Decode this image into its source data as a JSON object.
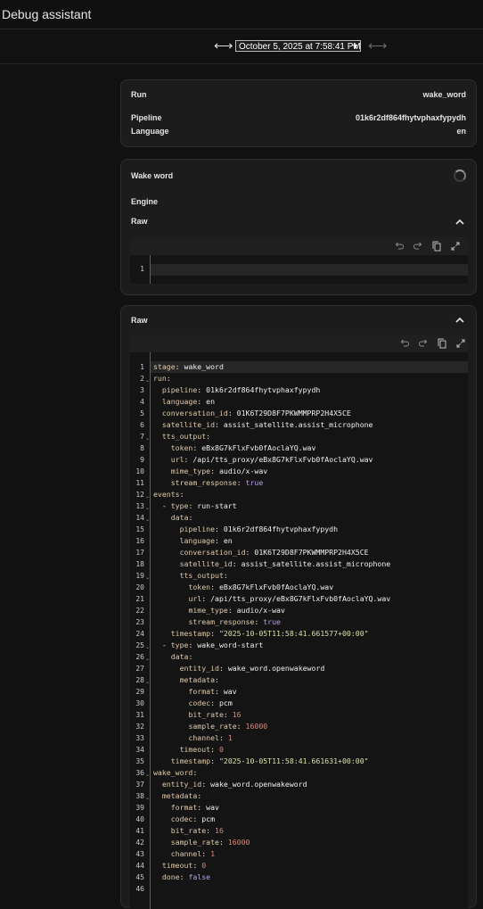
{
  "app": {
    "title": "Debug assistant"
  },
  "navigation": {
    "selected_run": "October 5, 2025 at 7:58:41 PM",
    "prev_icon": "arrow-left-right-icon",
    "next_icon": "arrow-left-right-icon"
  },
  "run_card": {
    "rows": [
      {
        "label": "Run",
        "value": "wake_word"
      },
      {
        "label": "Pipeline",
        "value": "01k6r2df864fhytvphaxfypydh"
      },
      {
        "label": "Language",
        "value": "en"
      }
    ]
  },
  "wake_word_card": {
    "title": "Wake word",
    "engine_label": "Engine",
    "raw_label": "Raw",
    "editor": {
      "line_numbers": [
        "1"
      ]
    }
  },
  "raw_card": {
    "title": "Raw",
    "editor": {
      "lines": [
        "stage: wake_word",
        "run:",
        "  pipeline: 01k6r2df864fhytvphaxfypydh",
        "  language: en",
        "  conversation_id: 01K6T29D8F7PKWMMPRP2H4X5CE",
        "  satellite_id: assist_satellite.assist_microphone",
        "  tts_output:",
        "    token: eBx8G7kFlxFvb0fAoclaYQ.wav",
        "    url: /api/tts_proxy/eBx8G7kFlxFvb0fAoclaYQ.wav",
        "    mime_type: audio/x-wav",
        "    stream_response: true",
        "events:",
        "  - type: run-start",
        "    data:",
        "      pipeline: 01k6r2df864fhytvphaxfypydh",
        "      language: en",
        "      conversation_id: 01K6T29D8F7PKWMMPRP2H4X5CE",
        "      satellite_id: assist_satellite.assist_microphone",
        "      tts_output:",
        "        token: eBx8G7kFlxFvb0fAoclaYQ.wav",
        "        url: /api/tts_proxy/eBx8G7kFlxFvb0fAoclaYQ.wav",
        "        mime_type: audio/x-wav",
        "        stream_response: true",
        "    timestamp: \"2025-10-05T11:58:41.661577+00:00\"",
        "  - type: wake_word-start",
        "    data:",
        "      entity_id: wake_word.openwakeword",
        "      metadata:",
        "        format: wav",
        "        codec: pcm",
        "        bit_rate: 16",
        "        sample_rate: 16000",
        "        channel: 1",
        "      timeout: 0",
        "    timestamp: \"2025-10-05T11:58:41.661631+00:00\"",
        "wake_word:",
        "  entity_id: wake_word.openwakeword",
        "  metadata:",
        "    format: wav",
        "    codec: pcm",
        "    bit_rate: 16",
        "    sample_rate: 16000",
        "    channel: 1",
        "  timeout: 0",
        "  done: false",
        ""
      ],
      "foldable_lines": [
        2,
        7,
        12,
        13,
        14,
        19,
        25,
        26,
        28,
        36,
        38
      ]
    }
  },
  "colors": {
    "background": "#111111",
    "card": "#1c1c1c",
    "editor": "#141414",
    "key": "#e0c9a8",
    "number": "#d98b76",
    "boolean": "#b99ee9",
    "string": "#d8e0a6"
  },
  "icons": {
    "undo": "undo-icon",
    "redo": "redo-icon",
    "copy": "copy-icon",
    "fullscreen": "fullscreen-icon",
    "collapse": "chevron-up-icon",
    "loading": "spinner-icon"
  }
}
